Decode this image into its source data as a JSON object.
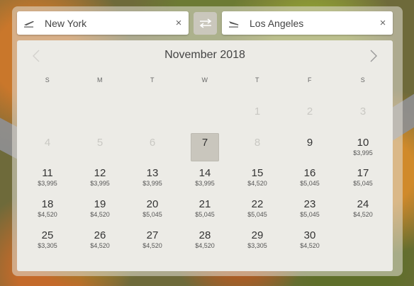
{
  "from": {
    "label": "New York",
    "clear": "×"
  },
  "to": {
    "label": "Los Angeles",
    "clear": "×"
  },
  "calendar": {
    "month": "November 2018",
    "weekdays": [
      "S",
      "M",
      "T",
      "W",
      "T",
      "F",
      "S"
    ],
    "selected_day": "7",
    "days": [
      {
        "d": "1",
        "p": "",
        "dis": true
      },
      {
        "d": "2",
        "p": "",
        "dis": true
      },
      {
        "d": "3",
        "p": "",
        "dis": true
      },
      {
        "d": "4",
        "p": "",
        "dis": true
      },
      {
        "d": "5",
        "p": "",
        "dis": true
      },
      {
        "d": "6",
        "p": "",
        "dis": true
      },
      {
        "d": "7",
        "p": "",
        "dis": false
      },
      {
        "d": "8",
        "p": "",
        "dis": true
      },
      {
        "d": "9",
        "p": "",
        "dis": false
      },
      {
        "d": "10",
        "p": "$3,995",
        "dis": false
      },
      {
        "d": "11",
        "p": "$3,995",
        "dis": false
      },
      {
        "d": "12",
        "p": "$3,995",
        "dis": false
      },
      {
        "d": "13",
        "p": "$3,995",
        "dis": false
      },
      {
        "d": "14",
        "p": "$3,995",
        "dis": false
      },
      {
        "d": "15",
        "p": "$4,520",
        "dis": false
      },
      {
        "d": "16",
        "p": "$5,045",
        "dis": false
      },
      {
        "d": "17",
        "p": "$5,045",
        "dis": false
      },
      {
        "d": "18",
        "p": "$4,520",
        "dis": false
      },
      {
        "d": "19",
        "p": "$4,520",
        "dis": false
      },
      {
        "d": "20",
        "p": "$5,045",
        "dis": false
      },
      {
        "d": "21",
        "p": "$5,045",
        "dis": false
      },
      {
        "d": "22",
        "p": "$5,045",
        "dis": false
      },
      {
        "d": "23",
        "p": "$5,045",
        "dis": false
      },
      {
        "d": "24",
        "p": "$4,520",
        "dis": false
      },
      {
        "d": "25",
        "p": "$3,305",
        "dis": false
      },
      {
        "d": "26",
        "p": "$4,520",
        "dis": false
      },
      {
        "d": "27",
        "p": "$4,520",
        "dis": false
      },
      {
        "d": "28",
        "p": "$4,520",
        "dis": false
      },
      {
        "d": "29",
        "p": "$3,305",
        "dis": false
      },
      {
        "d": "30",
        "p": "$4,520",
        "dis": false
      }
    ]
  },
  "icons": {
    "from": "plane-takeoff-icon",
    "to": "plane-landing-icon",
    "swap": "swap-arrows-icon",
    "prev": "chevron-left-icon",
    "next": "chevron-right-icon"
  }
}
